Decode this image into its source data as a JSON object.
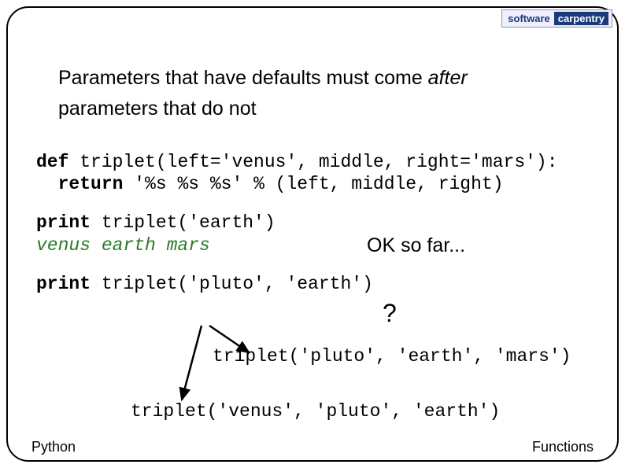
{
  "logo": {
    "left": "software",
    "right": "carpentry"
  },
  "body": {
    "line1_before": "Parameters that have defaults must come ",
    "line1_italic": "after",
    "line2": "parameters that do not"
  },
  "code": {
    "def_line": "def triplet(left='venus', middle, right='mars'):",
    "return_line": "  return '%s %s %s' % (left, middle, right)",
    "print1": "print triplet('earth')",
    "out1": "venus earth mars",
    "print2": "print triplet('pluto', 'earth')"
  },
  "annot": {
    "ok": "OK so far...",
    "q": "?"
  },
  "options": {
    "opt1": "triplet('pluto', 'earth', 'mars')",
    "opt2": "triplet('venus', 'pluto', 'earth')"
  },
  "footer": {
    "left": "Python",
    "right": "Functions"
  }
}
